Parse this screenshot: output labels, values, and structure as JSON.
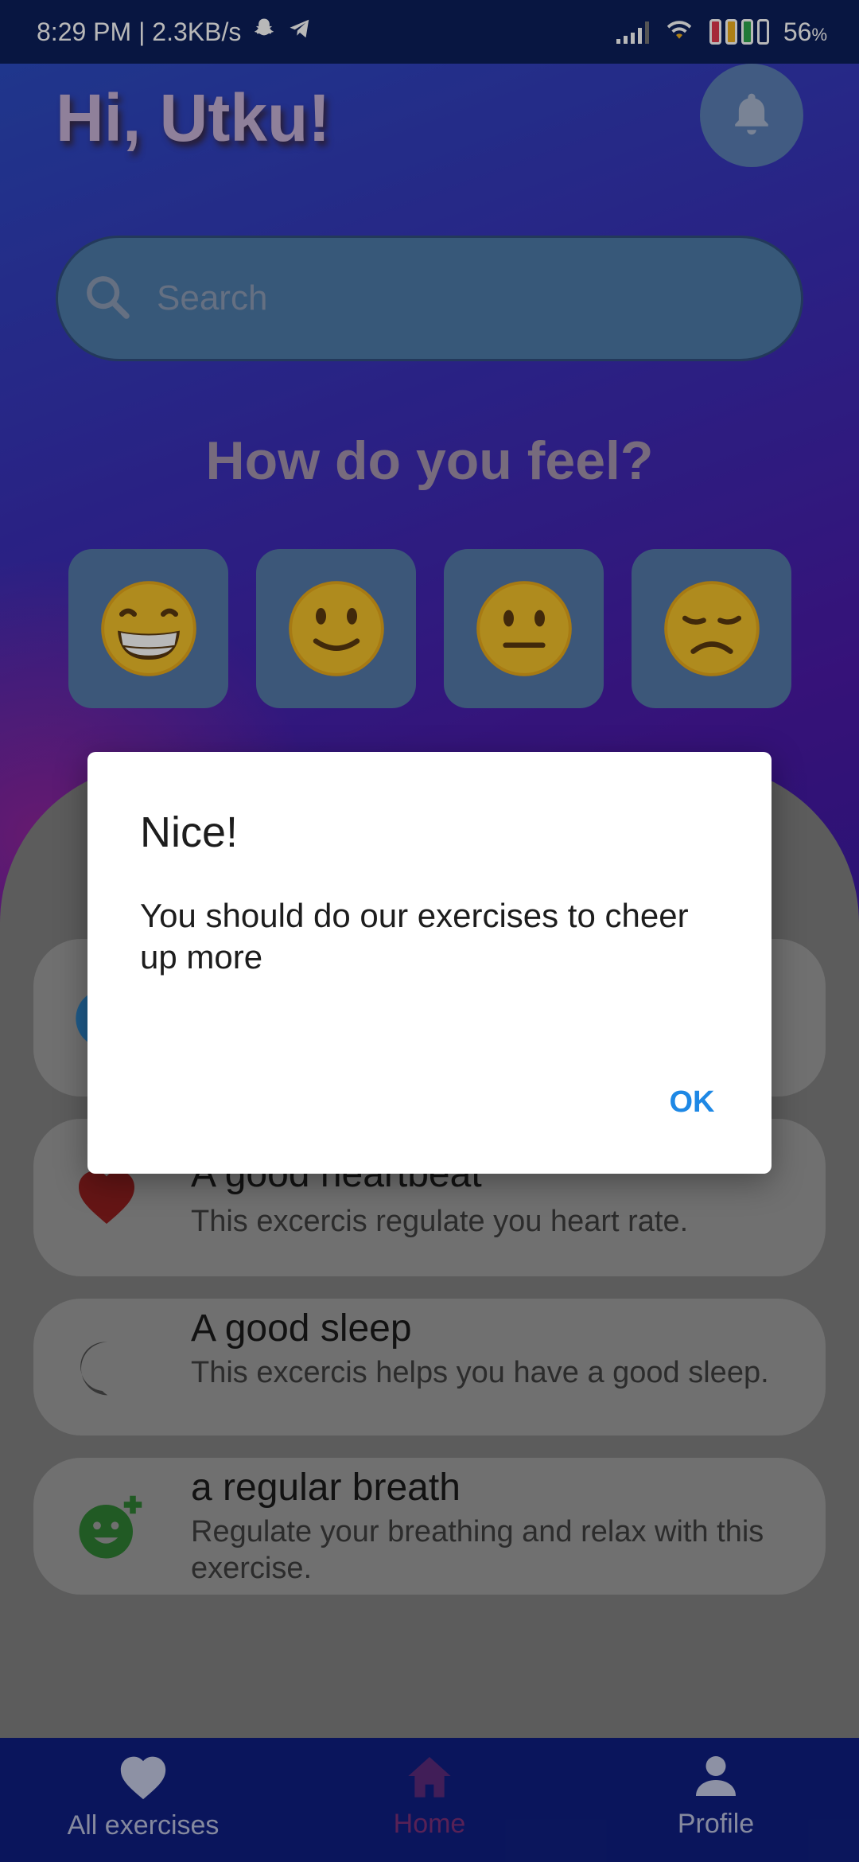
{
  "status_bar": {
    "time_speed": "8:29 PM | 2.3KB/s",
    "battery_percent": "56",
    "battery_unit": "%",
    "icons": [
      "snapchat-icon",
      "telegram-icon",
      "signal-icon",
      "wifi-icon",
      "battery-icon"
    ]
  },
  "header": {
    "greeting": "Hi, Utku!",
    "bell_icon": "bell-icon"
  },
  "search": {
    "placeholder": "Search",
    "icon": "search-icon"
  },
  "mood": {
    "title": "How do you feel?",
    "options": [
      {
        "emoji": "😁",
        "name": "very-happy"
      },
      {
        "emoji": "🙂",
        "name": "happy"
      },
      {
        "emoji": "😐",
        "name": "neutral"
      },
      {
        "emoji": "😞",
        "name": "sad"
      }
    ]
  },
  "exercises": [
    {
      "title": "A good heartbeat",
      "description": "This excercis regulate you heart rate.",
      "icon": "heart-icon"
    },
    {
      "title": "A good sleep",
      "description": "This excercis helps you have a good sleep.",
      "icon": "moon-icon"
    },
    {
      "title": "a regular breath",
      "description": "Regulate your breathing and relax with this exercise.",
      "icon": "smile-plus-icon"
    }
  ],
  "bottom_nav": {
    "items": [
      {
        "label": "All exercises",
        "icon": "heart-icon"
      },
      {
        "label": "Home",
        "icon": "home-icon",
        "active": true
      },
      {
        "label": "Profile",
        "icon": "person-icon"
      }
    ]
  },
  "dialog": {
    "title": "Nice!",
    "message": "You should do our exercises to cheer up more",
    "ok_label": "OK"
  },
  "colors": {
    "accent": "#1e88e5",
    "nav_background": "#0f1e80",
    "active_nav": "#7a2e78"
  }
}
